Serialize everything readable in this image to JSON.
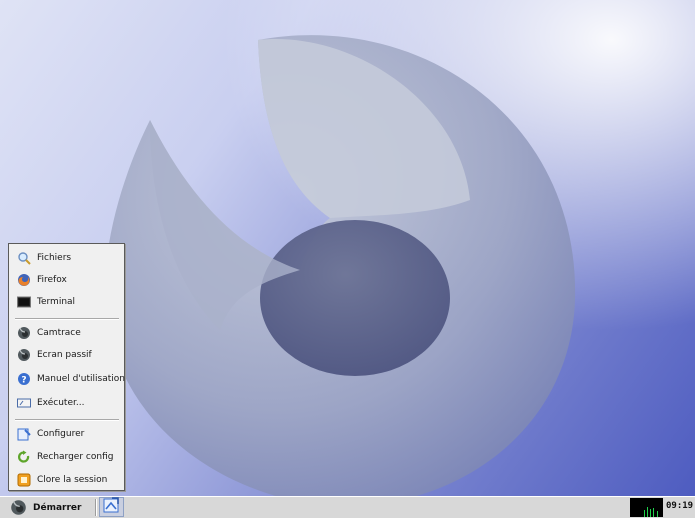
{
  "start_menu": {
    "items": [
      {
        "label": "Fichiers",
        "icon": "magnifier-icon"
      },
      {
        "label": "Firefox",
        "icon": "firefox-icon"
      },
      {
        "label": "Terminal",
        "icon": "terminal-icon"
      },
      {
        "label": "Camtrace",
        "icon": "camtrace-icon"
      },
      {
        "label": "Ecran passif",
        "icon": "camtrace-icon"
      },
      {
        "label": "Manuel d'utilisation",
        "icon": "help-icon"
      },
      {
        "label": "Exécuter...",
        "icon": "run-icon"
      },
      {
        "label": "Configurer",
        "icon": "configure-icon"
      },
      {
        "label": "Recharger config",
        "icon": "reload-icon"
      },
      {
        "label": "Clore la session",
        "icon": "logout-icon"
      }
    ]
  },
  "taskbar": {
    "start_label": "Démarrer",
    "clock": "09:19"
  },
  "colors": {
    "desktop_top": "#dfe3f5",
    "desktop_bottom": "#4e5cc0",
    "taskbar": "#d8d8d8",
    "menu_bg": "#f0f0f0"
  }
}
